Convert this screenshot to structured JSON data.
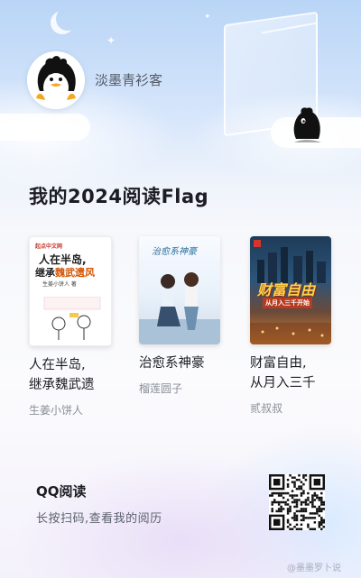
{
  "profile": {
    "username": "淡墨青衫客"
  },
  "page": {
    "title": "我的2024阅读Flag"
  },
  "books": [
    {
      "title_line1": "人在半岛,",
      "title_line2": "继承魏武遗",
      "author": "生姜小饼人",
      "cover": {
        "publisher": "起点中文网",
        "title_a": "人在半岛,",
        "title_b": "继承",
        "title_c": "魏武遗风",
        "author": "生姜小饼人 著"
      }
    },
    {
      "title_line1": "治愈系神豪",
      "title_line2": "",
      "author": "榴莲圆子",
      "cover": {
        "title": "治愈系神豪"
      }
    },
    {
      "title_line1": "财富自由,",
      "title_line2": "从月入三千",
      "author": "贰叔叔",
      "cover": {
        "title": "财富自由",
        "subtitle": "从月入三千开始"
      }
    }
  ],
  "footer": {
    "app_name": "QQ阅读",
    "instruction": "长按扫码,查看我的阅历"
  },
  "watermark": "@墨墨罗卜说",
  "colors": {
    "title": "#1b1d22",
    "subtext": "#8a8f99",
    "sky": "#b9d5f6"
  }
}
